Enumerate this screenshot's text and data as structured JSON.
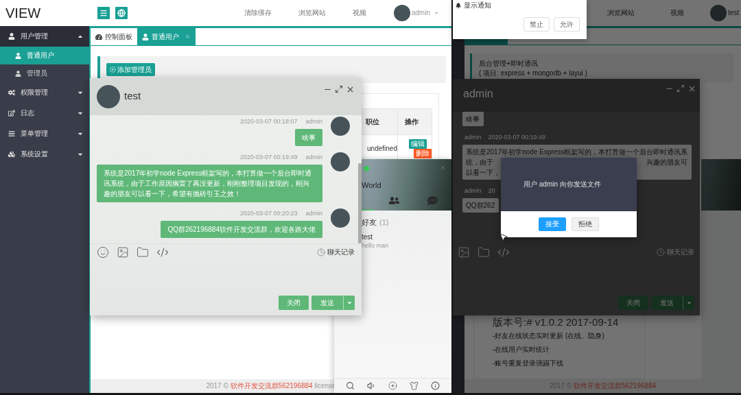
{
  "left_window": {
    "header": {
      "logo": "VIEW",
      "nav": [
        "清除缓存",
        "浏览网站",
        "视频"
      ],
      "user": "admin"
    },
    "sidebar": {
      "items": [
        {
          "label": "用户管理",
          "expanded": true,
          "children": [
            {
              "label": "普通用户",
              "selected": true
            },
            {
              "label": "管理员",
              "selected": false
            }
          ]
        },
        {
          "label": "权限管理",
          "expanded": false
        },
        {
          "label": "日志",
          "expanded": false
        },
        {
          "label": "菜单管理",
          "expanded": false
        },
        {
          "label": "系统设置",
          "expanded": false
        }
      ]
    },
    "tabs": [
      {
        "label": "控制面板",
        "selected": false,
        "closable": false
      },
      {
        "label": "普通用户",
        "selected": true,
        "closable": true
      }
    ],
    "add_button": "添加管理员",
    "table": {
      "columns": [
        "职位",
        "操作"
      ],
      "rows": [
        {
          "cells": [
            "undefined"
          ],
          "actions": [
            {
              "label": "编辑",
              "kind": "edit"
            },
            {
              "label": "删除",
              "kind": "delete"
            }
          ]
        }
      ]
    },
    "footer": {
      "text": "2017 ©",
      "link": "软件开发交流群562196884",
      "suffix": "license"
    }
  },
  "chat_window": {
    "title": "test",
    "messages": [
      {
        "time": "2020-03-07 00:18:07",
        "user": "admin",
        "text": "啥事"
      },
      {
        "time": "2020-03-07 00:19:49",
        "user": "admin",
        "text": "系统是2017年初学node Express框架写的，本打算做一个后台即时通讯系统，由于工作原因搁置了再没更新，刚刚整理项目发现的，刚兴趣的朋友可以看一下，希望有抛砖引玉之效！"
      },
      {
        "time": "2020-03-07 00:20:23",
        "user": "admin",
        "text": "QQ群262196884软件开发交流群，欢迎各路大佬"
      }
    ],
    "history": "聊天记录",
    "close_button": "关闭",
    "send_button": "发送"
  },
  "friend_panel": {
    "online": true,
    "name": "World",
    "tabs": [
      {
        "selected": true
      },
      {
        "selected": false
      },
      {
        "selected": false
      }
    ],
    "group": {
      "title": "好友",
      "count": "(1)"
    },
    "friends": [
      {
        "name": "test",
        "sign": "hello man"
      }
    ]
  },
  "right_window": {
    "header": {
      "nav": [
        "浏览网站",
        "视频"
      ],
      "user": "test"
    },
    "tabs": [
      {
        "selected": true
      }
    ],
    "intro": {
      "title": "后台管理+即时通讯",
      "subtitle": "( 项目: express + mongodb + layui )"
    },
    "chat_window": {
      "title": "admin",
      "messages": [
        {
          "lines": [
            [
              "啥事"
            ]
          ]
        },
        {
          "user": "admin",
          "time": "2020-03-07 00:19:49",
          "lines": [
            [
              "系统是2017年初学node Express框架写的，本打算做一个后台即时通讯系"
            ],
            [
              "统，由于",
              "兴趣的朋友可"
            ],
            [
              "以看一下，"
            ]
          ]
        },
        {
          "user": "admin",
          "time": "20",
          "lines": [
            [
              "QQ群262"
            ]
          ]
        }
      ],
      "history": "聊天记录",
      "close_button": "关闭",
      "send_button": "发送"
    },
    "version": {
      "title": "版本号:# v1.0.2 2017-09-14",
      "items": [
        "-好友在线状态实时更新 (在线、隐身)",
        "-在线用户实时统计",
        "-账号重复登录强踢下线"
      ]
    },
    "footer": {
      "text": "2017 ©",
      "link": "软件开发交流群562196884"
    }
  },
  "notification": {
    "text": "显示通知",
    "buttons": [
      "禁止",
      "允许"
    ]
  },
  "file_dialog": {
    "message": "用户 admin 向你发送文件",
    "buttons": [
      {
        "label": "接受",
        "kind": "primary"
      },
      {
        "label": "拒绝",
        "kind": "secondary"
      }
    ]
  }
}
